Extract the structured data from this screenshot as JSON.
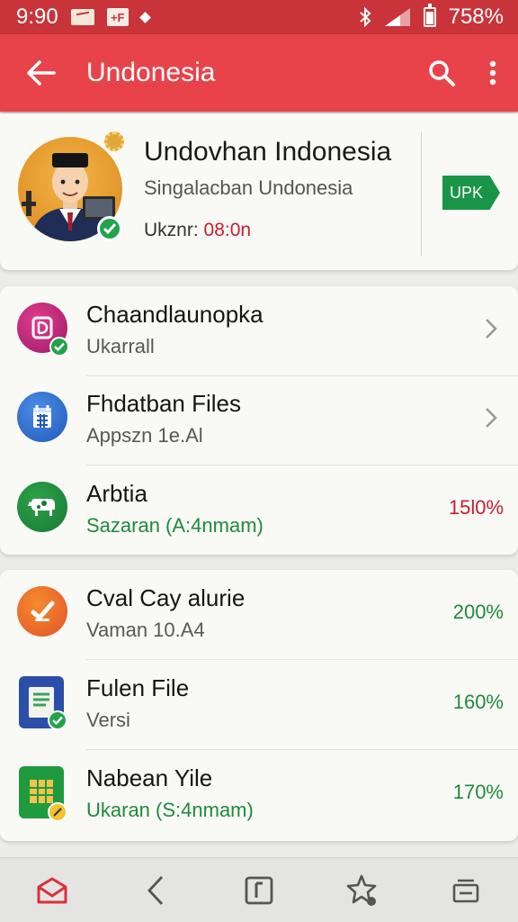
{
  "status_bar": {
    "time": "9:90",
    "battery_text": "758%"
  },
  "app_bar": {
    "title": "Undonesia"
  },
  "profile": {
    "name": "Undovhan Indonesia",
    "subtitle": "Singalacban Undonesia",
    "meta_label": "Ukznr: ",
    "meta_value": "08:0n",
    "tag": "UPK"
  },
  "group_a": [
    {
      "title": "Chaandlaunopka",
      "subtitle": "Ukarrall",
      "trailing": "chevron"
    },
    {
      "title": "Fhdatban Files",
      "subtitle": "Appszn 1e.Al",
      "trailing": "chevron"
    },
    {
      "title": "Arbtia",
      "subtitle": "Sazaran (A:4nmam)",
      "percent": "15l0%"
    }
  ],
  "group_b": [
    {
      "title": "Cval Cay alurie",
      "subtitle": "Vaman 10.A4",
      "percent": "200%"
    },
    {
      "title": "Fulen File",
      "subtitle": "Versi",
      "percent": "160%"
    },
    {
      "title": "Nabean Yile",
      "subtitle": "Ukaran (S:4nmam)",
      "percent": "170%"
    }
  ],
  "icons": {
    "row_1": "app-d-icon",
    "row_2": "calendar-file-icon",
    "row_3": "cow-icon",
    "row_4": "checkmark-circle-icon",
    "row_5": "document-icon",
    "row_6": "spreadsheet-icon"
  },
  "colors": {
    "status_bar": "#c8343a",
    "app_bar": "#e8434a",
    "accent_green": "#1e8a3c",
    "accent_red": "#c81e2e"
  }
}
